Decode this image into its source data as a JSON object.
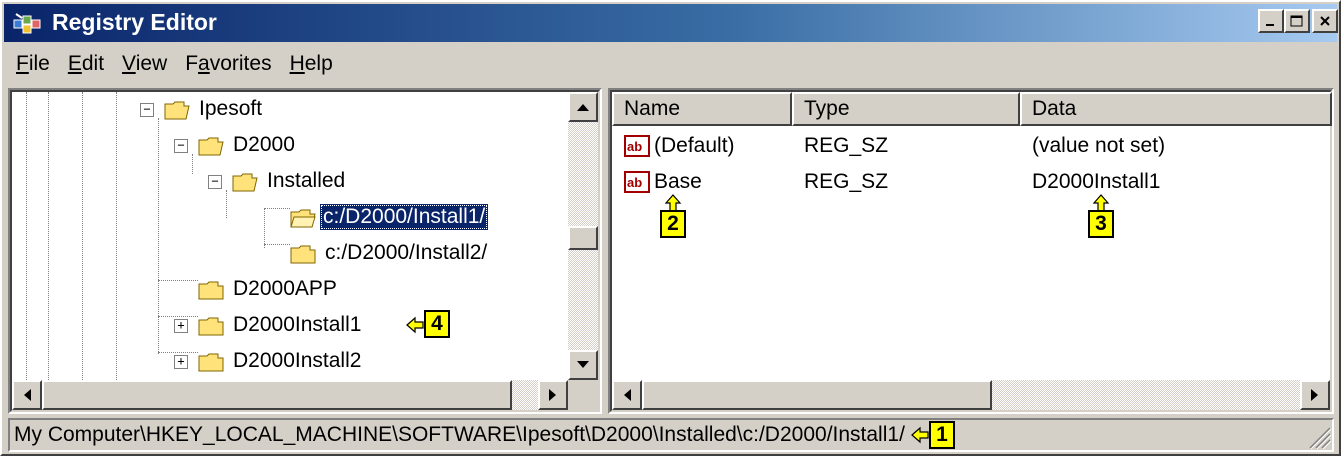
{
  "window": {
    "title": "Registry Editor"
  },
  "menu": [
    {
      "label": "File",
      "mnemonic": "F"
    },
    {
      "label": "Edit",
      "mnemonic": "E"
    },
    {
      "label": "View",
      "mnemonic": "V"
    },
    {
      "label": "Favorites",
      "mnemonic": "a"
    },
    {
      "label": "Help",
      "mnemonic": "H"
    }
  ],
  "tree": {
    "items": [
      {
        "label": "Ipesoft",
        "expander": "−",
        "selected": false
      },
      {
        "label": "D2000",
        "expander": "−",
        "selected": false
      },
      {
        "label": "Installed",
        "expander": "−",
        "selected": false
      },
      {
        "label": "c:/D2000/Install1/",
        "expander": "",
        "selected": true
      },
      {
        "label": "c:/D2000/Install2/",
        "expander": "",
        "selected": false
      },
      {
        "label": "D2000APP",
        "expander": "",
        "selected": false
      },
      {
        "label": "D2000Install1",
        "expander": "+",
        "selected": false
      },
      {
        "label": "D2000Install2",
        "expander": "+",
        "selected": false
      }
    ]
  },
  "list": {
    "columns": [
      "Name",
      "Type",
      "Data"
    ],
    "rows": [
      {
        "name": "(Default)",
        "type": "REG_SZ",
        "data": "(value not set)",
        "icon": "string-value-icon"
      },
      {
        "name": "Base",
        "type": "REG_SZ",
        "data": "D2000Install1",
        "icon": "string-value-icon"
      }
    ]
  },
  "status": {
    "path": "My Computer\\HKEY_LOCAL_MACHINE\\SOFTWARE\\Ipesoft\\D2000\\Installed\\c:/D2000/Install1/"
  },
  "callouts": {
    "c1": "1",
    "c2": "2",
    "c3": "3",
    "c4": "4"
  },
  "colors": {
    "titlebar_start": "#0a246a",
    "titlebar_end": "#a6caf0",
    "selection": "#0a246a",
    "badge": "#ffff00",
    "face": "#d4d0c8"
  }
}
